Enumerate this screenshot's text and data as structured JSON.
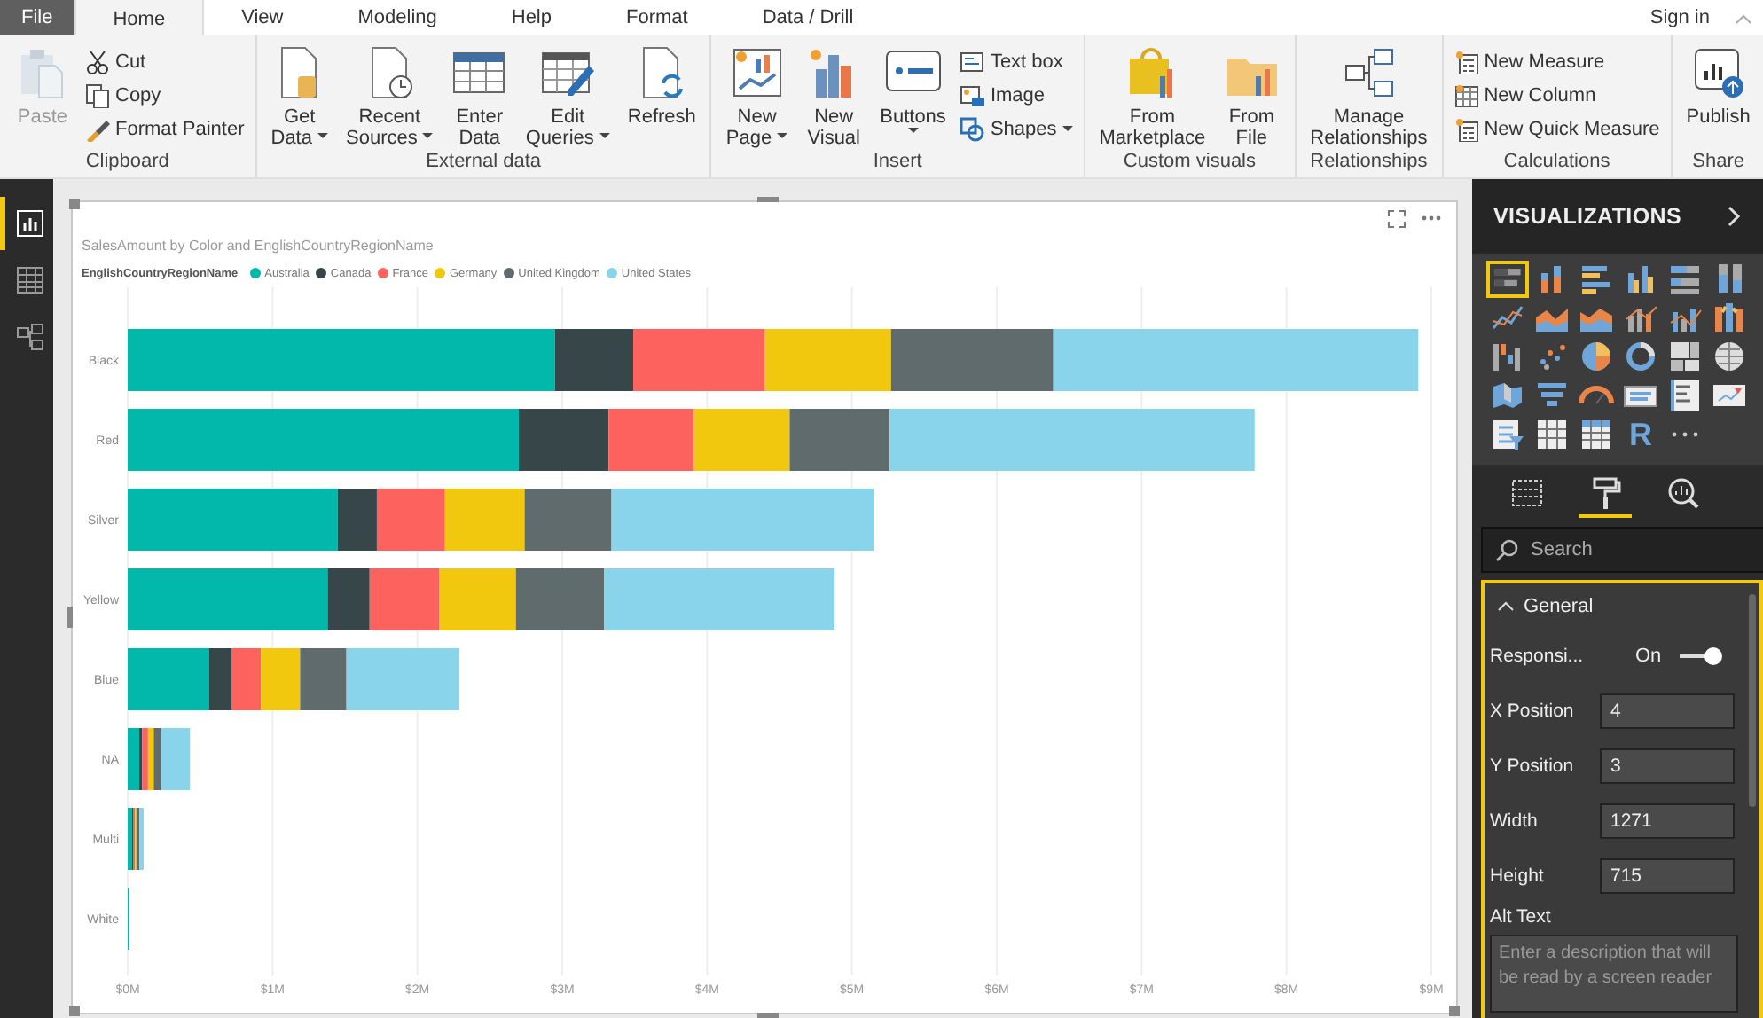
{
  "tabs": [
    {
      "label": "File",
      "kind": "file",
      "selected": false
    },
    {
      "label": "Home",
      "kind": "tab",
      "selected": true
    },
    {
      "label": "View",
      "kind": "tab",
      "selected": false
    },
    {
      "label": "Modeling",
      "kind": "tab",
      "selected": false
    },
    {
      "label": "Help",
      "kind": "tab",
      "selected": false
    },
    {
      "label": "Format",
      "kind": "tab",
      "selected": false
    },
    {
      "label": "Data / Drill",
      "kind": "tab",
      "selected": false
    }
  ],
  "sign_in": "Sign in",
  "ribbon": [
    {
      "label": "Clipboard",
      "items": [
        {
          "label": "Paste",
          "kind": "large",
          "dropdown": false,
          "disabled": true
        },
        {
          "label": "Cut",
          "kind": "small",
          "dropdown": false,
          "disabled": false
        },
        {
          "label": "Copy",
          "kind": "small",
          "dropdown": false,
          "disabled": false
        },
        {
          "label": "Format Painter",
          "kind": "small",
          "dropdown": false,
          "disabled": false
        }
      ]
    },
    {
      "label": "External data",
      "items": [
        {
          "label": "Get Data",
          "kind": "large",
          "dropdown": true,
          "disabled": false
        },
        {
          "label": "Recent Sources",
          "kind": "large",
          "dropdown": true,
          "disabled": false
        },
        {
          "label": "Enter Data",
          "kind": "large",
          "dropdown": false,
          "disabled": false
        },
        {
          "label": "Edit Queries",
          "kind": "large",
          "dropdown": true,
          "disabled": false
        },
        {
          "label": "Refresh",
          "kind": "large",
          "dropdown": false,
          "disabled": false
        }
      ]
    },
    {
      "label": "Insert",
      "items": [
        {
          "label": "New Page",
          "kind": "large",
          "dropdown": true,
          "disabled": false
        },
        {
          "label": "New Visual",
          "kind": "large",
          "dropdown": false,
          "disabled": false
        },
        {
          "label": "Buttons",
          "kind": "large",
          "dropdown": true,
          "disabled": false
        },
        {
          "label": "Text box",
          "kind": "small",
          "dropdown": false,
          "disabled": false
        },
        {
          "label": "Image",
          "kind": "small",
          "dropdown": false,
          "disabled": false
        },
        {
          "label": "Shapes",
          "kind": "small",
          "dropdown": true,
          "disabled": false
        }
      ]
    },
    {
      "label": "Custom visuals",
      "items": [
        {
          "label": "From Marketplace",
          "kind": "large",
          "dropdown": false,
          "disabled": false
        },
        {
          "label": "From File",
          "kind": "large",
          "dropdown": false,
          "disabled": false
        }
      ]
    },
    {
      "label": "Relationships",
      "items": [
        {
          "label": "Manage Relationships",
          "kind": "large",
          "dropdown": false,
          "disabled": false
        }
      ]
    },
    {
      "label": "Calculations",
      "items": [
        {
          "label": "New Measure",
          "kind": "small",
          "dropdown": false,
          "disabled": false
        },
        {
          "label": "New Column",
          "kind": "small",
          "dropdown": false,
          "disabled": false
        },
        {
          "label": "New Quick Measure",
          "kind": "small",
          "dropdown": false,
          "disabled": false
        }
      ]
    },
    {
      "label": "Share",
      "items": [
        {
          "label": "Publish",
          "kind": "large",
          "dropdown": false,
          "disabled": false
        }
      ]
    }
  ],
  "nav": [
    {
      "kind": "report",
      "selected": true
    },
    {
      "kind": "data",
      "selected": false
    },
    {
      "kind": "model",
      "selected": false
    }
  ],
  "visual": {
    "legend_title": "EnglishCountryRegionName",
    "chart_data": {
      "type": "bar",
      "orientation": "horizontal",
      "stacked": true,
      "grid": true,
      "title": "SalesAmount by Color and EnglishCountryRegionName",
      "categories": [
        "Black",
        "Red",
        "Silver",
        "Yellow",
        "Blue",
        "NA",
        "Multi",
        "White"
      ],
      "series": [
        {
          "name": "Australia",
          "color": "#01b8aa",
          "values": [
            2.95,
            2.7,
            1.45,
            1.38,
            0.56,
            0.08,
            0.03,
            0.01
          ]
        },
        {
          "name": "Canada",
          "color": "#374649",
          "values": [
            0.54,
            0.62,
            0.27,
            0.29,
            0.16,
            0.02,
            0.01,
            0
          ]
        },
        {
          "name": "France",
          "color": "#fd625e",
          "values": [
            0.91,
            0.59,
            0.47,
            0.48,
            0.2,
            0.04,
            0.01,
            0
          ]
        },
        {
          "name": "Germany",
          "color": "#f2c80f",
          "values": [
            0.87,
            0.66,
            0.55,
            0.53,
            0.27,
            0.04,
            0.01,
            0
          ]
        },
        {
          "name": "United Kingdom",
          "color": "#5f6b6d",
          "values": [
            1.12,
            0.69,
            0.6,
            0.61,
            0.32,
            0.05,
            0.02,
            0
          ]
        },
        {
          "name": "United States",
          "color": "#8ad4eb",
          "values": [
            2.52,
            2.52,
            1.81,
            1.59,
            0.78,
            0.2,
            0.03,
            0
          ]
        }
      ],
      "xlim": [
        0,
        9
      ],
      "xticks": [
        {
          "value": 0,
          "label": "$0M"
        },
        {
          "value": 1,
          "label": "$1M"
        },
        {
          "value": 2,
          "label": "$2M"
        },
        {
          "value": 3,
          "label": "$3M"
        },
        {
          "value": 4,
          "label": "$4M"
        },
        {
          "value": 5,
          "label": "$5M"
        },
        {
          "value": 6,
          "label": "$6M"
        },
        {
          "value": 7,
          "label": "$7M"
        },
        {
          "value": 8,
          "label": "$8M"
        },
        {
          "value": 9,
          "label": "$9M"
        }
      ]
    }
  },
  "viz_pane": {
    "title": "VISUALIZATIONS",
    "gallery": [
      {
        "kind": "stacked-bar",
        "selected": true
      },
      {
        "kind": "stacked-column",
        "selected": false
      },
      {
        "kind": "clustered-bar",
        "selected": false
      },
      {
        "kind": "clustered-column",
        "selected": false
      },
      {
        "kind": "bar-100",
        "selected": false
      },
      {
        "kind": "column-100",
        "selected": false
      },
      {
        "kind": "line",
        "selected": false
      },
      {
        "kind": "area",
        "selected": false
      },
      {
        "kind": "stacked-area",
        "selected": false
      },
      {
        "kind": "line-column",
        "selected": false
      },
      {
        "kind": "line-clustered",
        "selected": false
      },
      {
        "kind": "ribbon",
        "selected": false
      },
      {
        "kind": "waterfall",
        "selected": false
      },
      {
        "kind": "scatter",
        "selected": false
      },
      {
        "kind": "pie",
        "selected": false
      },
      {
        "kind": "donut",
        "selected": false
      },
      {
        "kind": "treemap",
        "selected": false
      },
      {
        "kind": "map",
        "selected": false
      },
      {
        "kind": "filled-map",
        "selected": false
      },
      {
        "kind": "funnel",
        "selected": false
      },
      {
        "kind": "gauge",
        "selected": false
      },
      {
        "kind": "card",
        "selected": false
      },
      {
        "kind": "multirow-card",
        "selected": false
      },
      {
        "kind": "kpi",
        "selected": false
      },
      {
        "kind": "slicer",
        "selected": false
      },
      {
        "kind": "table",
        "selected": false
      },
      {
        "kind": "matrix",
        "selected": false
      },
      {
        "kind": "r",
        "label": "R",
        "selected": false
      },
      {
        "kind": "more",
        "selected": false
      }
    ],
    "pane_tabs": [
      {
        "kind": "fields",
        "selected": false
      },
      {
        "kind": "format",
        "selected": true
      },
      {
        "kind": "analytics",
        "selected": false
      }
    ],
    "search": {
      "placeholder": "Search"
    },
    "section": {
      "title": "General",
      "expanded": true,
      "fields": [
        {
          "kind": "toggle",
          "label": "Responsi...",
          "value": "On",
          "on": true
        },
        {
          "kind": "number",
          "label": "X Position",
          "value": "4"
        },
        {
          "kind": "number",
          "label": "Y Position",
          "value": "3"
        },
        {
          "kind": "number",
          "label": "Width",
          "value": "1271"
        },
        {
          "kind": "number",
          "label": "Height",
          "value": "715"
        },
        {
          "kind": "textarea",
          "label": "Alt Text",
          "placeholder": "Enter a description that will be read by a screen reader"
        }
      ]
    }
  }
}
